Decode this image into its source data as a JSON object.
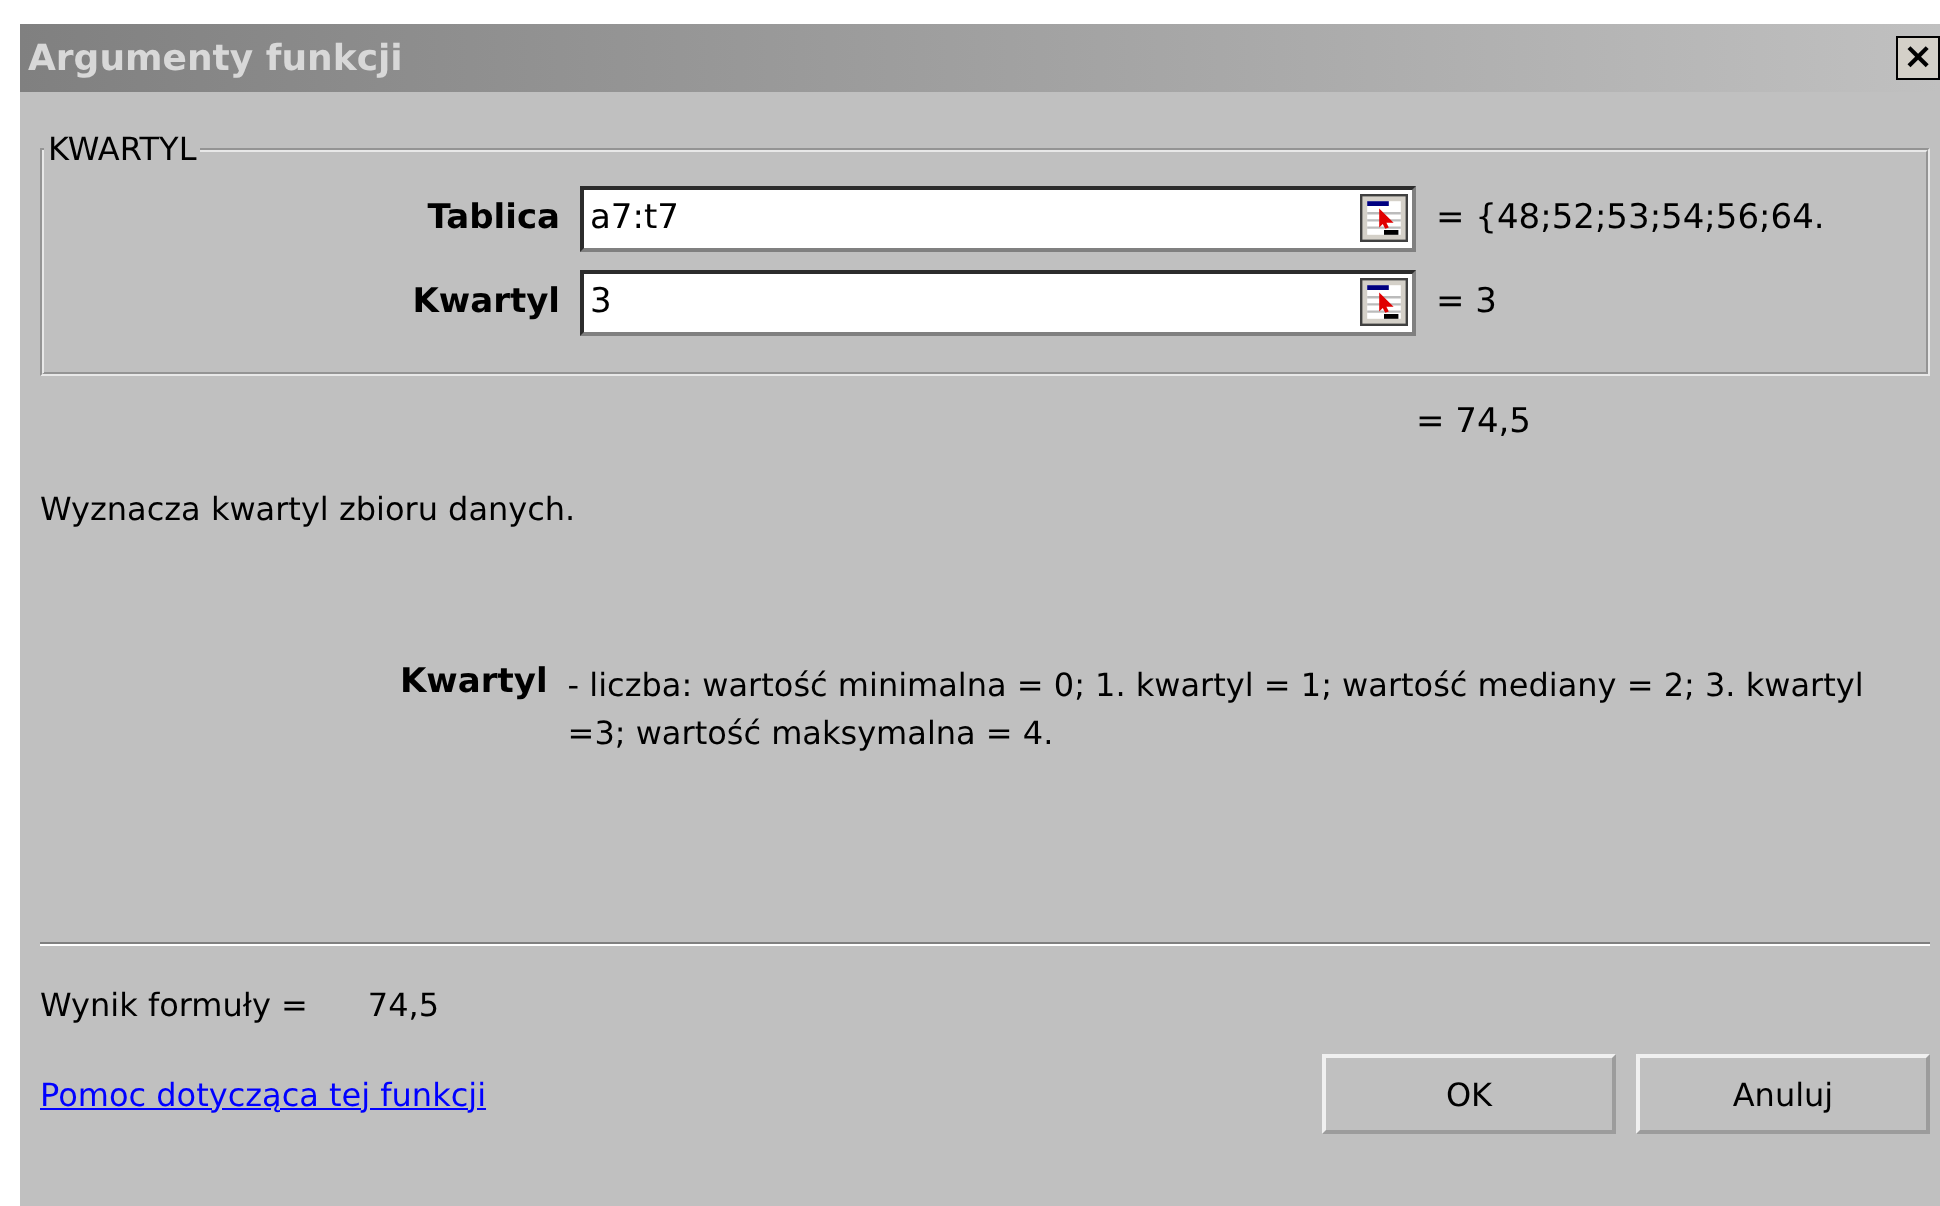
{
  "window": {
    "title": "Argumenty funkcji",
    "close": "×"
  },
  "function_group": {
    "legend": "KWARTYL",
    "arguments": [
      {
        "label": "Tablica",
        "value": "a7:t7",
        "result": "= {48;52;53;54;56;64."
      },
      {
        "label": "Kwartyl",
        "value": "3",
        "result": "= 3"
      }
    ]
  },
  "function_result": "= 74,5",
  "description": "Wyznacza kwartyl zbioru danych.",
  "argument_help": {
    "name": "Kwartyl",
    "text": "- liczba: wartość minimalna = 0; 1. kwartyl = 1; wartość mediany = 2; 3. kwartyl =3; wartość maksymalna = 4."
  },
  "formula_result": {
    "label": "Wynik formuły =",
    "value": "74,5"
  },
  "help_link": "Pomoc dotycząca tej funkcji",
  "buttons": [
    "OK",
    "Anuluj"
  ]
}
